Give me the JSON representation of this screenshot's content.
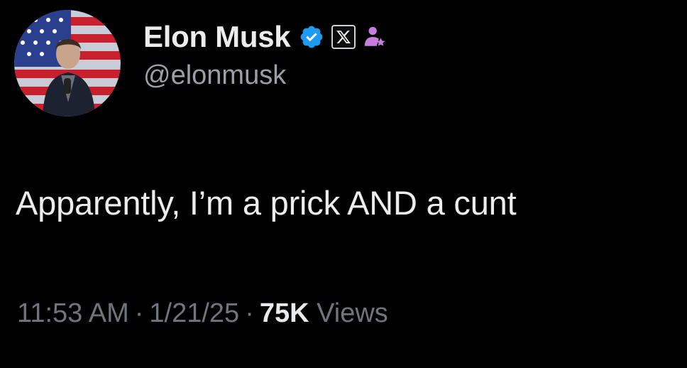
{
  "tweet": {
    "author": {
      "display_name": "Elon Musk",
      "handle": "@elonmusk",
      "verified_icon": "verified-badge-icon",
      "org_icon": "x-logo-icon",
      "affiliate_icon": "affiliate-person-icon"
    },
    "text": "Apparently, I’m a prick AND a cunt",
    "time": "11:53 AM",
    "date": "1/21/25",
    "separator": "·",
    "views_count": "75K",
    "views_label": "Views"
  },
  "colors": {
    "background": "#000000",
    "verified_blue": "#1d9bf0",
    "affiliate_purple": "#c77ddb",
    "muted_text": "#6f757b"
  }
}
